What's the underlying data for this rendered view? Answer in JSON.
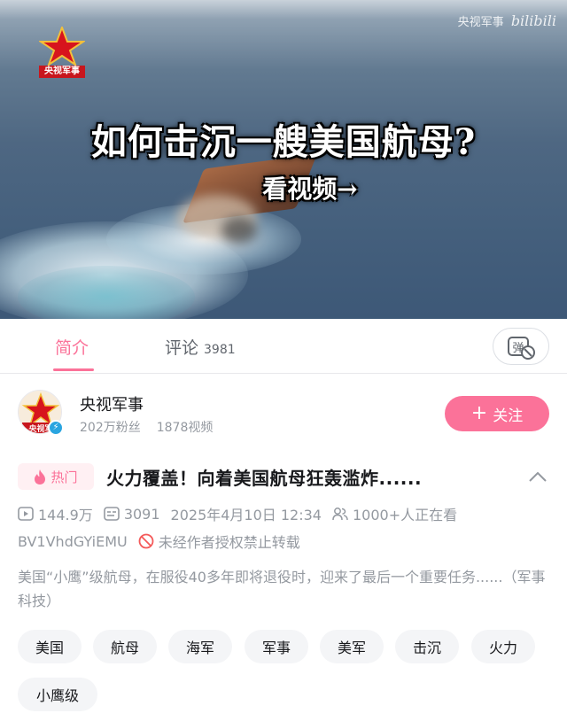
{
  "video": {
    "title_overlay": "如何击沉一艘美国航母?",
    "subtitle_overlay": "看视频→",
    "channel_logo_text": "央视军事",
    "watermark_channel": "央视军事",
    "watermark_brand": "bilibili"
  },
  "tabs": [
    {
      "label": "简介",
      "active": true
    },
    {
      "label": "评论",
      "count": "3981"
    }
  ],
  "danmaku_button": {
    "icon": "danmaku-off-icon",
    "glyph": "弹"
  },
  "uploader": {
    "name": "央视军事",
    "fans": "202万粉丝",
    "videos": "1878视频",
    "avatar_text": "央视军",
    "follow_label": "关注"
  },
  "title_section": {
    "hot_label": "热门",
    "title": "火力覆盖！向着美国航母狂轰滥炸......",
    "views": "144.9万",
    "danmaku": "3091",
    "datetime": "2025年4月10日 12:34",
    "watching": "1000+人正在看",
    "bvid": "BV1VhdGYiEMU",
    "copyright": "未经作者授权禁止转载"
  },
  "description": "美国“小鹰”级航母，在服役40多年即将退役时，迎来了最后一个重要任务......（军事科技）",
  "tags": [
    "美国",
    "航母",
    "海军",
    "军事",
    "美军",
    "击沉",
    "火力",
    "小鹰级"
  ],
  "colors": {
    "accent": "#fb7299",
    "muted": "#9499a0",
    "text": "#18191c",
    "tag_bg": "#f4f5f7"
  }
}
